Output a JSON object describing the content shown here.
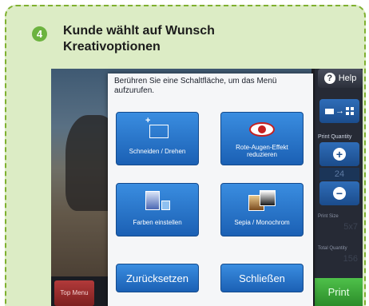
{
  "step": {
    "number": "4",
    "title": "Kunde wählt auf Wunsch Kreativoptionen"
  },
  "kiosk": {
    "help_label": "Help",
    "print_quantity_label": "Print Quantity",
    "quantity_value": "24",
    "print_size_label": "Print Size",
    "print_size_value": "5x7",
    "total_quantity_label": "Total Quantity",
    "total_quantity_value": "156",
    "print_label": "Print",
    "top_menu_label": "Top Menu"
  },
  "dialog": {
    "message": "Berühren Sie eine Schaltfläche, um das Menü aufzurufen.",
    "tiles": [
      {
        "label": "Schneiden / Drehen",
        "icon": "crop-icon"
      },
      {
        "label": "Rote-Augen-Effekt reduzieren",
        "icon": "red-eye-icon"
      },
      {
        "label": "Farben einstellen",
        "icon": "color-adjust-icon"
      },
      {
        "label": "Sepia / Monochrom",
        "icon": "sepia-icon"
      }
    ],
    "reset_label": "Zurücksetzen",
    "close_label": "Schließen"
  },
  "colors": {
    "frame_bg": "#dcecc5",
    "frame_border": "#7fb030",
    "badge": "#6cb33f",
    "button_blue": "#1b60b4",
    "print_green": "#2c8c2a",
    "top_menu_red": "#9b2a2a"
  }
}
